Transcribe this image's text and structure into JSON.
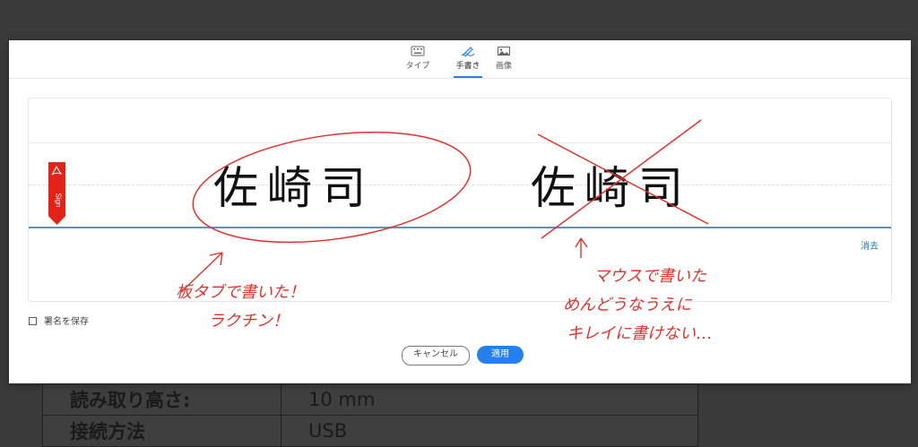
{
  "background": {
    "rows": [
      {
        "label": "読み取り高さ:",
        "value": "10 mm"
      },
      {
        "label": "接続方法",
        "value": "USB"
      }
    ]
  },
  "modal": {
    "tabs": [
      {
        "label": "タイプ",
        "icon": "keyboard-icon",
        "active": false
      },
      {
        "label": "手書き",
        "icon": "pen-icon",
        "active": true
      },
      {
        "label": "画像",
        "icon": "image-icon",
        "active": false
      }
    ],
    "sign_flag_text": "Sign",
    "clear_label": "消去",
    "save_signature_label": "署名を保存",
    "cancel_label": "キャンセル",
    "apply_label": "適用"
  },
  "annotations": {
    "signature_left": "佐崎司",
    "signature_right": "佐崎司",
    "note_left_line1": "板タブで書いた！",
    "note_left_line2": "ラクチン！",
    "note_right_line1": "マウスで書いた",
    "note_right_line2": "めんどうなうえに",
    "note_right_line3": "キレイに書けない…"
  },
  "colors": {
    "accent": "#2680eb",
    "ink_red": "#e0312c",
    "sign_flag": "#e2231a"
  }
}
